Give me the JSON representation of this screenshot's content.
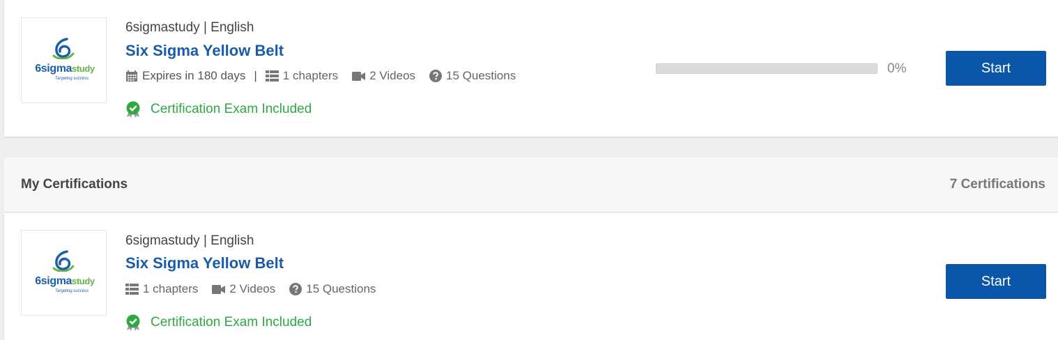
{
  "colors": {
    "accent": "#0b56a8",
    "title": "#1a5ca8",
    "success": "#2fa844",
    "background": "#eeeeee"
  },
  "logo": {
    "name_part1": "6sigma",
    "name_part2": "study",
    "tagline": "Targeting success"
  },
  "courses": [
    {
      "provider": "6sigmastudy | English",
      "title": "Six Sigma Yellow Belt",
      "expires": "Expires in 180 days",
      "separator": "|",
      "chapters": "1 chapters",
      "videos": "2 Videos",
      "questions": "15 Questions",
      "certification": "Certification Exam Included",
      "progress_value": 0,
      "progress_label": "0%",
      "button_label": "Start"
    }
  ],
  "certifications_section": {
    "title": "My Certifications",
    "count_label": "7 Certifications",
    "items": [
      {
        "provider": "6sigmastudy | English",
        "title": "Six Sigma Yellow Belt",
        "chapters": "1 chapters",
        "videos": "2 Videos",
        "questions": "15 Questions",
        "certification": "Certification Exam Included",
        "button_label": "Start"
      }
    ]
  },
  "icons": {
    "expires": "calendar-icon",
    "chapters": "list-icon",
    "videos": "video-camera-icon",
    "questions": "question-circle-icon",
    "certification": "certificate-badge-icon"
  }
}
